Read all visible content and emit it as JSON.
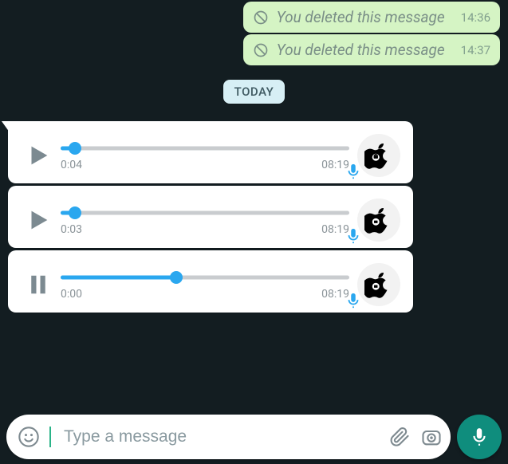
{
  "deleted": {
    "text": "You deleted this message",
    "items": [
      {
        "time": "14:36"
      },
      {
        "time": "14:37"
      }
    ]
  },
  "date_label": "TODAY",
  "voice": [
    {
      "state": "play",
      "current": "0:04",
      "stamp": "08:19",
      "progress_pct": 5
    },
    {
      "state": "play",
      "current": "0:03",
      "stamp": "08:19",
      "progress_pct": 5
    },
    {
      "state": "pause",
      "current": "0:00",
      "stamp": "08:19",
      "progress_pct": 40
    }
  ],
  "composer": {
    "placeholder": "Type a message"
  },
  "colors": {
    "accent_blue": "#2aa7ef",
    "accent_green": "#0f8d7d",
    "bubble_out": "#d5f4c4",
    "bubble_in": "#ffffff",
    "bg": "#131d21"
  }
}
